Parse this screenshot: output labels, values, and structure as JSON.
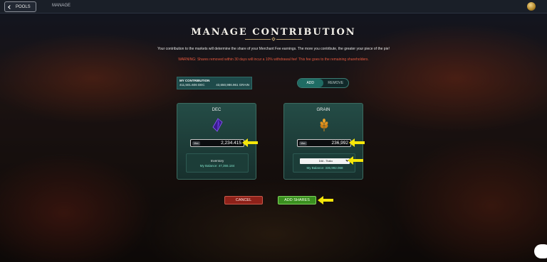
{
  "topbar": {
    "back_label": "POOLS",
    "manage_label": "MANAGE"
  },
  "header": {
    "title": "MANAGE CONTRIBUTION",
    "subtitle": "Your contribution to the markets will determine the share of your Merchant Fee earnings. The more you contribute, the greater your piece of the pie!",
    "warning": "WARNING: Shares removed within 30 days will incur a 10% withdrawal fee! This fee goes to the remaining shareholders."
  },
  "contribution": {
    "label": "MY CONTRIBUTION",
    "dec": "411,501.606 DEC",
    "grain": "43,650,986.961 GRAIN"
  },
  "toggle": {
    "add": "ADD",
    "remove": "REMOVE",
    "active": "add"
  },
  "dec_card": {
    "title": "DEC",
    "max_label": "Max",
    "amount": "2,234.415",
    "inventory_label": "Inventory",
    "balance": "My Balance: 47,355.184",
    "icon": "dec-crystal-icon"
  },
  "grain_card": {
    "title": "GRAIN",
    "max_label": "Max",
    "amount": "236,992",
    "select_value": "D46 - Thabo",
    "balance": "My Balance: 336,992.068",
    "icon": "grain-wheat-icon"
  },
  "actions": {
    "cancel": "CANCEL",
    "add_shares": "ADD SHARES"
  },
  "colors": {
    "accent": "#1f6c64",
    "warning": "#e85a3f",
    "cancel": "#8e2119",
    "confirm": "#3a8f1f",
    "annotation_arrow": "#f5e60a"
  }
}
